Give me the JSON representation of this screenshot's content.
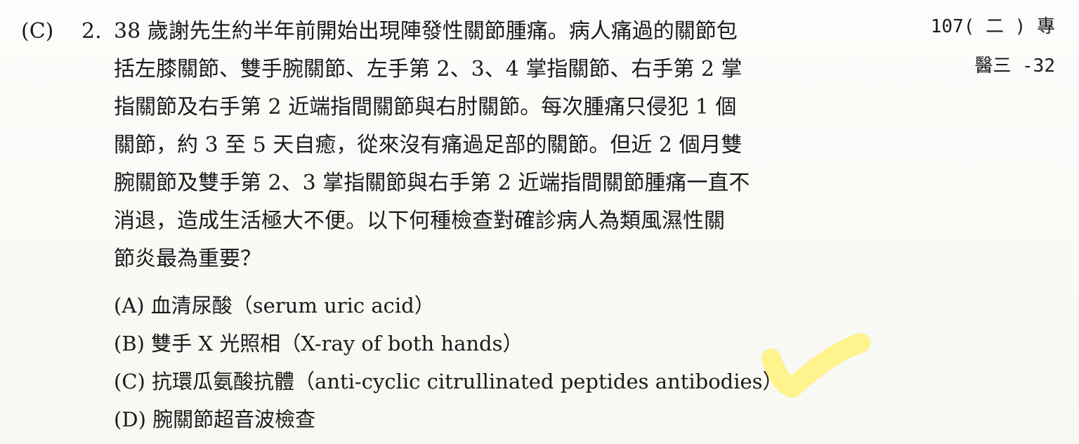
{
  "question": {
    "answer_label": "(C)",
    "number_label": "2. ",
    "stem_lines": [
      "38 歲謝先生約半年前開始出現陣發性關節腫痛。病人痛過的關節包",
      "括左膝關節、雙手腕關節、左手第 2、3、4 掌指關節、右手第 2 掌",
      "指關節及右手第 2 近端指間關節與右肘關節。每次腫痛只侵犯 1 個",
      "關節，約 3 至 5 天自癒，從來沒有痛過足部的關節。但近 2 個月雙",
      "腕關節及雙手第 2、3 掌指關節與右手第 2 近端指間關節腫痛一直不",
      "消退，造成生活極大不便。以下何種檢查對確診病人為類風濕性關",
      "節炎最為重要？"
    ],
    "options": [
      "(A) 血清尿酸（serum uric acid）",
      "(B) 雙手 X 光照相（X-ray of both hands）",
      "(C) 抗環瓜氨酸抗體（anti-cyclic citrullinated peptides antibodies）",
      "(D) 腕關節超音波檢查"
    ]
  },
  "source": {
    "line1": "107( 二 ) 專",
    "line2": "醫三 -32"
  },
  "colors": {
    "text": "#1b1b1b",
    "highlighter": "#fff27a",
    "paper": "#fbfbf8"
  }
}
